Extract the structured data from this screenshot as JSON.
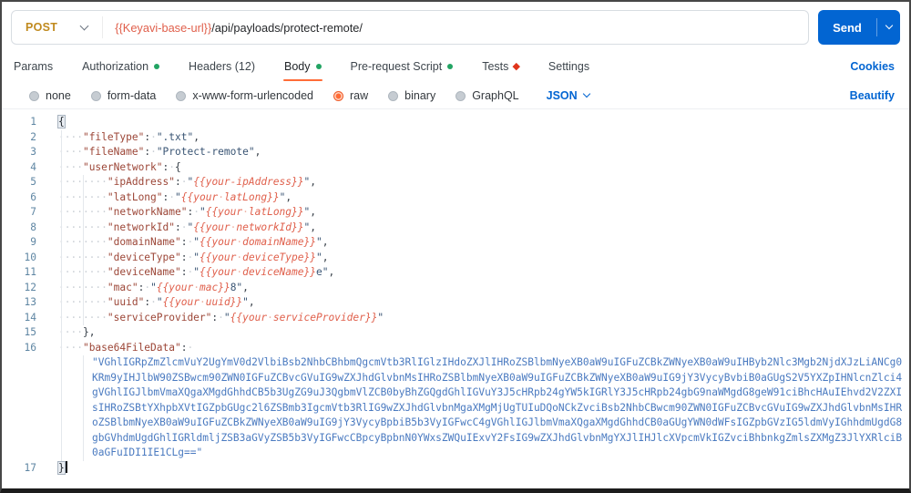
{
  "request_bar": {
    "method": "POST",
    "url_variable": "{{Keyavi-base-url}}",
    "url_path": "/api/payloads/protect-remote/",
    "send_label": "Send"
  },
  "tabs": [
    {
      "label": "Params",
      "indicator": "none",
      "active": false
    },
    {
      "label": "Authorization",
      "indicator": "dot-green",
      "active": false
    },
    {
      "label": "Headers (12)",
      "indicator": "none",
      "active": false
    },
    {
      "label": "Body",
      "indicator": "dot-green",
      "active": true
    },
    {
      "label": "Pre-request Script",
      "indicator": "dot-green",
      "active": false
    },
    {
      "label": "Tests",
      "indicator": "diamond-red",
      "active": false
    },
    {
      "label": "Settings",
      "indicator": "none",
      "active": false
    }
  ],
  "cookies_label": "Cookies",
  "body_bar": {
    "options": [
      {
        "label": "none",
        "selected": false
      },
      {
        "label": "form-data",
        "selected": false
      },
      {
        "label": "x-www-form-urlencoded",
        "selected": false
      },
      {
        "label": "raw",
        "selected": true
      },
      {
        "label": "binary",
        "selected": false
      },
      {
        "label": "GraphQL",
        "selected": false
      }
    ],
    "language": "JSON",
    "beautify_label": "Beautify"
  },
  "colors": {
    "accent_orange": "#ff6c37",
    "send_blue": "#0265d2",
    "method_post": "#c08a1e",
    "variable_red": "#e0604c",
    "status_green": "#22a463",
    "status_red": "#e0351b"
  },
  "editor": {
    "lines": [
      {
        "n": "1",
        "tokens": [
          [
            "brkt",
            "{"
          ]
        ]
      },
      {
        "n": "2",
        "tokens": [
          [
            "ws",
            "····"
          ],
          [
            "key",
            "\"fileType\""
          ],
          [
            "pun",
            ":"
          ],
          [
            "ws",
            "·"
          ],
          [
            "str",
            "\".txt\""
          ],
          [
            "pun",
            ","
          ]
        ]
      },
      {
        "n": "3",
        "tokens": [
          [
            "ws",
            "····"
          ],
          [
            "key",
            "\"fileName\""
          ],
          [
            "pun",
            ":"
          ],
          [
            "ws",
            "·"
          ],
          [
            "str",
            "\"Protect-remote\""
          ],
          [
            "pun",
            ","
          ]
        ]
      },
      {
        "n": "4",
        "tokens": [
          [
            "ws",
            "····"
          ],
          [
            "key",
            "\"userNetwork\""
          ],
          [
            "pun",
            ":"
          ],
          [
            "ws",
            "·"
          ],
          [
            "pun",
            "{"
          ]
        ]
      },
      {
        "n": "5",
        "tokens": [
          [
            "ws",
            "········"
          ],
          [
            "key",
            "\"ipAddress\""
          ],
          [
            "pun",
            ":"
          ],
          [
            "ws",
            "·"
          ],
          [
            "str",
            "\""
          ],
          [
            "var",
            "{{your-ipAddress}}"
          ],
          [
            "str",
            "\""
          ],
          [
            "pun",
            ","
          ]
        ]
      },
      {
        "n": "6",
        "tokens": [
          [
            "ws",
            "········"
          ],
          [
            "key",
            "\"latLong\""
          ],
          [
            "pun",
            ":"
          ],
          [
            "ws",
            "·"
          ],
          [
            "str",
            "\""
          ],
          [
            "var",
            "{{your"
          ],
          [
            "wsv",
            "·"
          ],
          [
            "var",
            "latLong}}"
          ],
          [
            "str",
            "\""
          ],
          [
            "pun",
            ","
          ]
        ]
      },
      {
        "n": "7",
        "tokens": [
          [
            "ws",
            "········"
          ],
          [
            "key",
            "\"networkName\""
          ],
          [
            "pun",
            ":"
          ],
          [
            "ws",
            "·"
          ],
          [
            "str",
            "\""
          ],
          [
            "var",
            "{{your"
          ],
          [
            "wsv",
            "·"
          ],
          [
            "var",
            "latLong}}"
          ],
          [
            "str",
            "\""
          ],
          [
            "pun",
            ","
          ]
        ]
      },
      {
        "n": "8",
        "tokens": [
          [
            "ws",
            "········"
          ],
          [
            "key",
            "\"networkId\""
          ],
          [
            "pun",
            ":"
          ],
          [
            "ws",
            "·"
          ],
          [
            "str",
            "\""
          ],
          [
            "var",
            "{{your"
          ],
          [
            "wsv",
            "·"
          ],
          [
            "var",
            "networkId}}"
          ],
          [
            "str",
            "\""
          ],
          [
            "pun",
            ","
          ]
        ]
      },
      {
        "n": "9",
        "tokens": [
          [
            "ws",
            "········"
          ],
          [
            "key",
            "\"domainName\""
          ],
          [
            "pun",
            ":"
          ],
          [
            "ws",
            "·"
          ],
          [
            "str",
            "\""
          ],
          [
            "var",
            "{{your"
          ],
          [
            "wsv",
            "·"
          ],
          [
            "var",
            "domainName}}"
          ],
          [
            "str",
            "\""
          ],
          [
            "pun",
            ","
          ]
        ]
      },
      {
        "n": "10",
        "tokens": [
          [
            "ws",
            "········"
          ],
          [
            "key",
            "\"deviceType\""
          ],
          [
            "pun",
            ":"
          ],
          [
            "ws",
            "·"
          ],
          [
            "str",
            "\""
          ],
          [
            "var",
            "{{your"
          ],
          [
            "wsv",
            "·"
          ],
          [
            "var",
            "deviceType}}"
          ],
          [
            "str",
            "\""
          ],
          [
            "pun",
            ","
          ]
        ]
      },
      {
        "n": "11",
        "tokens": [
          [
            "ws",
            "········"
          ],
          [
            "key",
            "\"deviceName\""
          ],
          [
            "pun",
            ":"
          ],
          [
            "ws",
            "·"
          ],
          [
            "str",
            "\""
          ],
          [
            "var",
            "{{your"
          ],
          [
            "wsv",
            "·"
          ],
          [
            "var",
            "deviceName}}"
          ],
          [
            "str",
            "e\""
          ],
          [
            "pun",
            ","
          ]
        ]
      },
      {
        "n": "12",
        "tokens": [
          [
            "ws",
            "········"
          ],
          [
            "key",
            "\"mac\""
          ],
          [
            "pun",
            ":"
          ],
          [
            "ws",
            "·"
          ],
          [
            "str",
            "\""
          ],
          [
            "var",
            "{{your"
          ],
          [
            "wsv",
            "·"
          ],
          [
            "var",
            "mac}}"
          ],
          [
            "str",
            "8\""
          ],
          [
            "pun",
            ","
          ]
        ]
      },
      {
        "n": "13",
        "tokens": [
          [
            "ws",
            "········"
          ],
          [
            "key",
            "\"uuid\""
          ],
          [
            "pun",
            ":"
          ],
          [
            "ws",
            "·"
          ],
          [
            "str",
            "\""
          ],
          [
            "var",
            "{{your"
          ],
          [
            "wsv",
            "·"
          ],
          [
            "var",
            "uuid}}"
          ],
          [
            "str",
            "\""
          ],
          [
            "pun",
            ","
          ]
        ]
      },
      {
        "n": "14",
        "tokens": [
          [
            "ws",
            "········"
          ],
          [
            "key",
            "\"serviceProvider\""
          ],
          [
            "pun",
            ":"
          ],
          [
            "ws",
            "·"
          ],
          [
            "str",
            "\""
          ],
          [
            "var",
            "{{your"
          ],
          [
            "wsv",
            "·"
          ],
          [
            "var",
            "serviceProvider}}"
          ],
          [
            "str",
            "\""
          ]
        ]
      },
      {
        "n": "15",
        "tokens": [
          [
            "ws",
            "····"
          ],
          [
            "pun",
            "},"
          ]
        ]
      },
      {
        "n": "16",
        "tokens": [
          [
            "ws",
            "····"
          ],
          [
            "key",
            "\"base64FileData\""
          ],
          [
            "pun",
            ":"
          ],
          [
            "ws",
            "·"
          ]
        ]
      },
      {
        "n": "",
        "wrap": true,
        "tokens": [
          [
            "b64",
            "\"VGhlIGRpZmZlcmVuY2UgYmV0d2VlbiBsb2NhbCBhbmQgcmVtb3RlIGlzIHdoZXJlIHRoZSBlbmNyeXB0aW9uIGFuZCBkZWNyeXB0aW9uIHByb2Nlc3Mgb2NjdXJzLiANCg0"
          ]
        ]
      },
      {
        "n": "",
        "wrap": true,
        "tokens": [
          [
            "b64",
            "KRm9yIHJlbW90ZSBwcm90ZWN0IGFuZCBvcGVuIG9wZXJhdGlvbnMsIHRoZSBlbmNyeXB0aW9uIGFuZCBkZWNyeXB0aW9uIG9jY3VycyBvbiB0aGUgS2V5YXZpIHNlcnZlci4"
          ]
        ]
      },
      {
        "n": "",
        "wrap": true,
        "tokens": [
          [
            "b64",
            "gVGhlIGJlbmVmaXQgaXMgdGhhdCB5b3UgZG9uJ3QgbmVlZCB0byBhZGQgdGhlIGVuY3J5cHRpb24gYW5kIGRlY3J5cHRpb24gbG9naWMgdG8geW91ciBhcHAuIEhvd2V2ZXI"
          ]
        ]
      },
      {
        "n": "",
        "wrap": true,
        "tokens": [
          [
            "b64",
            "sIHRoZSBtYXhpbXVtIGZpbGUgc2l6ZSBmb3IgcmVtb3RlIG9wZXJhdGlvbnMgaXMgMjUgTUIuDQoNCkZvciBsb2NhbCBwcm90ZWN0IGFuZCBvcGVuIG9wZXJhdGlvbnMsIHR"
          ]
        ]
      },
      {
        "n": "",
        "wrap": true,
        "tokens": [
          [
            "b64",
            "oZSBlbmNyeXB0aW9uIGFuZCBkZWNyeXB0aW9uIG9jY3VycyBpbiB5b3VyIGFwcC4gVGhlIGJlbmVmaXQgaXMgdGhhdCB0aGUgYWN0dWFsIGZpbGVzIG5ldmVyIGhhdmUgdG8"
          ]
        ]
      },
      {
        "n": "",
        "wrap": true,
        "tokens": [
          [
            "b64",
            "gbGVhdmUgdGhlIGRldmljZSB3aGVyZSB5b3VyIGFwcCBpcyBpbnN0YWxsZWQuIExvY2FsIG9wZXJhdGlvbnMgYXJlIHJlcXVpcmVkIGZvciBhbnkgZmlsZXMgZ3JlYXRlciB"
          ]
        ]
      },
      {
        "n": "",
        "wrap": true,
        "tokens": [
          [
            "b64",
            "0aGFuIDI1IE1CLg==\""
          ]
        ]
      },
      {
        "n": "17",
        "tokens": [
          [
            "brkt",
            "}"
          ],
          [
            "caret",
            ""
          ]
        ]
      }
    ]
  }
}
